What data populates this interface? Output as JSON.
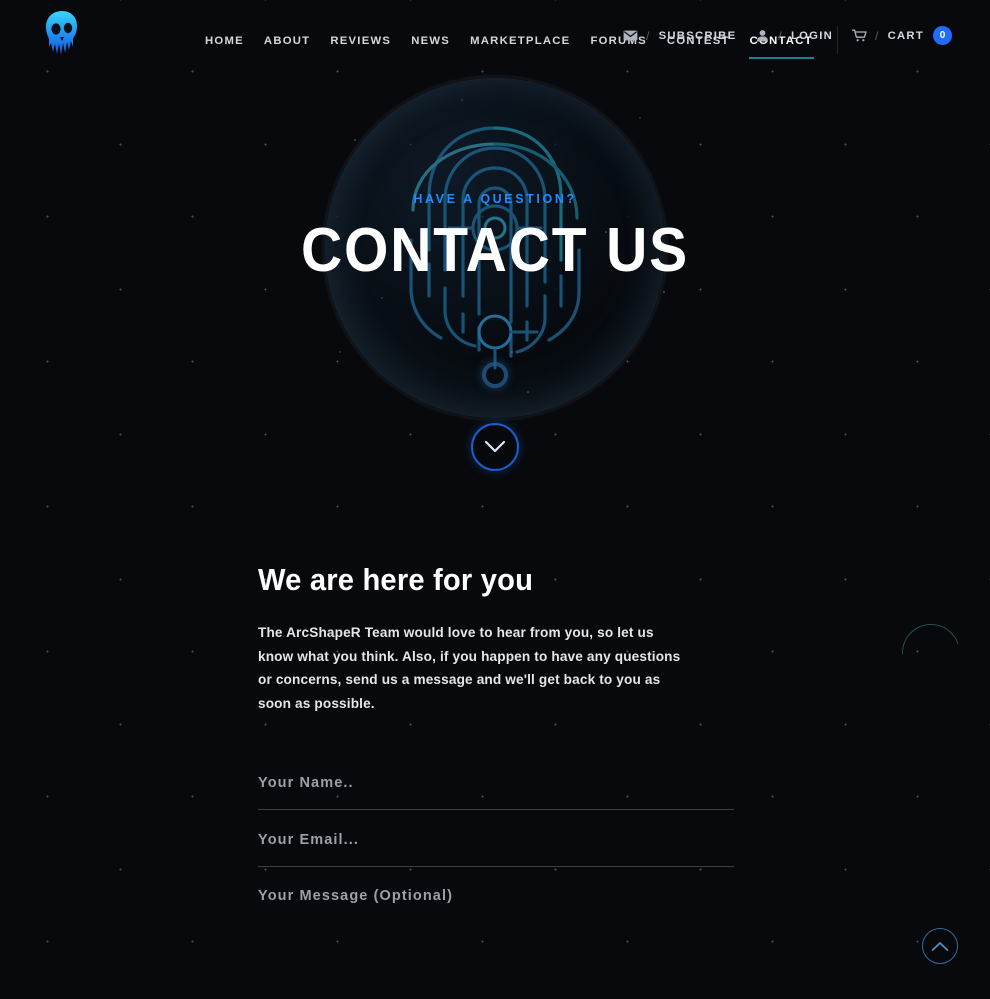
{
  "site": {
    "logo_name": "skull-logo",
    "brand": "ArcShapeR"
  },
  "nav": {
    "items": [
      {
        "label": "HOME",
        "active": false
      },
      {
        "label": "ABOUT",
        "active": false
      },
      {
        "label": "REVIEWS",
        "active": false
      },
      {
        "label": "NEWS",
        "active": false
      },
      {
        "label": "MARKETPLACE",
        "active": false
      },
      {
        "label": "FORUMS",
        "active": false
      },
      {
        "label": "CONTEST",
        "active": false
      },
      {
        "label": "CONTACT",
        "active": true
      }
    ],
    "utility": {
      "mail_icon": "envelope-icon",
      "subscribe_label": "SUBSCRIBE",
      "user_icon": "user-icon",
      "login_label": "LOGIN",
      "cart_icon": "cart-icon",
      "cart_label": "CART",
      "cart_count": "0",
      "separator": "/"
    }
  },
  "hero": {
    "kicker": "HAVE A QUESTION?",
    "title": "CONTACT US",
    "scroll_down_icon": "chevron-down-icon"
  },
  "main": {
    "heading": "We are here for you",
    "paragraph": "The ArcShapeR Team would love to hear from you, so let us know what you think. Also, if you happen to have any questions or concerns, send us a message and we'll get back to you as soon as possible."
  },
  "form": {
    "name_placeholder": "Your Name..",
    "name_value": "",
    "email_placeholder": "Your Email...",
    "email_value": "",
    "message_placeholder": "Your Message (Optional)",
    "message_value": ""
  },
  "decor": {
    "scroll_top_icon": "chevron-up-icon"
  },
  "colors": {
    "background": "#08090c",
    "accent_blue": "#1f8dff",
    "badge_blue": "#1f6dff",
    "underline_teal": "#1d7fa0",
    "text_light": "#e3e6ea",
    "placeholder": "#9aa1ab"
  }
}
